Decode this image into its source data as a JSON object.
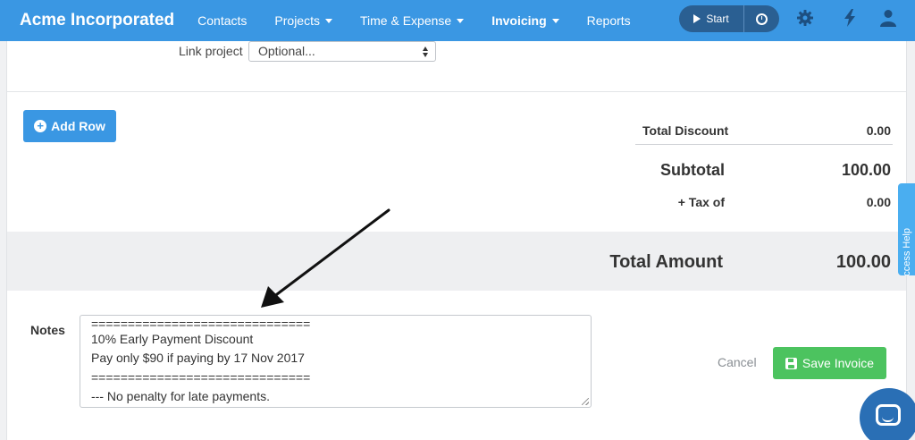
{
  "header": {
    "brand": "Acme Incorporated",
    "nav": [
      {
        "label": "Contacts"
      },
      {
        "label": "Projects"
      },
      {
        "label": "Time & Expense"
      },
      {
        "label": "Invoicing"
      },
      {
        "label": "Reports"
      }
    ],
    "timer_label": "Start",
    "icons": [
      "play-icon",
      "clock-icon",
      "gear-icon",
      "bolt-icon",
      "user-icon"
    ]
  },
  "form": {
    "link_project_label": "Link project",
    "link_project_value": "Optional...",
    "add_row_label": "Add Row",
    "totals": {
      "discount_label": "Total Discount",
      "discount_value": "0.00",
      "subtotal_label": "Subtotal",
      "subtotal_value": "100.00",
      "tax_label": "+ Tax of",
      "tax_value": "0.00",
      "total_label": "Total Amount",
      "total_value": "100.00"
    },
    "notes_label": "Notes",
    "notes_lines": [
      "==============================",
      "10% Early Payment Discount",
      "Pay only $90 if paying by 17 Nov 2017",
      "==============================",
      "--- No penalty for late payments."
    ],
    "cancel_label": "Cancel",
    "save_label": "Save Invoice"
  },
  "side": {
    "help_tab_label": "Access Help"
  },
  "colors": {
    "primary": "#3a97e3",
    "success": "#4cc35f",
    "timer": "#2a5f92"
  }
}
